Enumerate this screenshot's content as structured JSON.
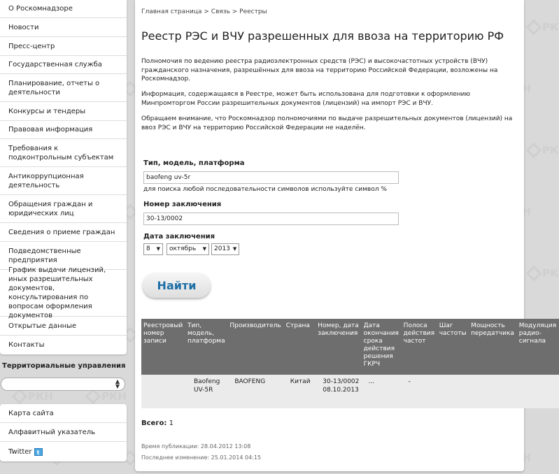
{
  "sidebar": {
    "menu": [
      "О Роскомнадзоре",
      "Новости",
      "Пресс-центр",
      "Государственная служба",
      "Планирование, отчеты о деятельности",
      "Конкурсы и тендеры",
      "Правовая информация",
      "Требования к подконтрольным субъектам",
      "Антикоррупционная деятельность",
      "Обращения граждан и юридических лиц",
      "Сведения о приеме граждан",
      "Подведомственные предприятия",
      "График выдачи лицензий, иных разрешительных документов, консультирования по вопросам оформления документов",
      "Открытые данные",
      "Контакты"
    ],
    "regions_title": "Территориальные управления",
    "regions_value": "",
    "menu2": [
      "Карта сайта",
      "Алфавитный указатель",
      "Twitter"
    ]
  },
  "main": {
    "breadcrumb": "Главная страница > Связь > Реестры",
    "title": "Реестр РЭС и ВЧУ разрешенных для ввоза на территорию РФ",
    "paragraphs": [
      "Полномочия по ведению реестра радиоэлектронных средств (РЭС) и высокочастотных устройств (ВЧУ) гражданского назначения, разрешённых для ввоза на территорию Российской Федерации, возложены на Роскомнадзор.",
      "Информация, содержащаяся в Реестре, может быть использована для подготовки к оформлению Минпромторгом России разрешительных документов (лицензий) на импорт РЭС и ВЧУ.",
      "Обращаем внимание, что Роскомнадзор полномочиями по выдаче разрешительных документов (лицензий) на ввоз РЭС и ВЧУ на территорию Российской Федерации не наделён."
    ],
    "form": {
      "type_label": "Тип, модель, платформа",
      "type_value": "baofeng uv-5r",
      "hint": "для поиска любой последовательности символов используйте символ %",
      "number_label": "Номер заключения",
      "number_value": "30-13/0002",
      "date_label": "Дата заключения",
      "day": "8",
      "month": "октябрь",
      "year": "2013",
      "submit": "Найти"
    },
    "table": {
      "headers": [
        "Реестровый номер записи",
        "Тип, модель, платформа",
        "Производитель",
        "Страна",
        "Номер, дата заключения",
        "Дата окончания срока действия решения ГКРЧ",
        "Полоса действия частот",
        "Шаг частоты",
        "Мощность передатчика",
        "Модуляция радио-сигнала"
      ],
      "rows": [
        [
          "",
          "Baofeng UV-5R",
          "BAOFENG",
          "Китай",
          "30-13/0002 08.10.2013",
          "...",
          "-",
          "",
          "",
          ""
        ]
      ]
    },
    "total_label": "Всего:",
    "total_value": "1",
    "published": "Время публикации: 28.04.2012 13:08",
    "modified": "Последнее изменение: 25.01.2014 04:15"
  },
  "watermark_text": "РКН",
  "colors": {
    "accent": "#1e6fa6",
    "table_header": "#6e6e6e",
    "row": "#ebebeb"
  }
}
